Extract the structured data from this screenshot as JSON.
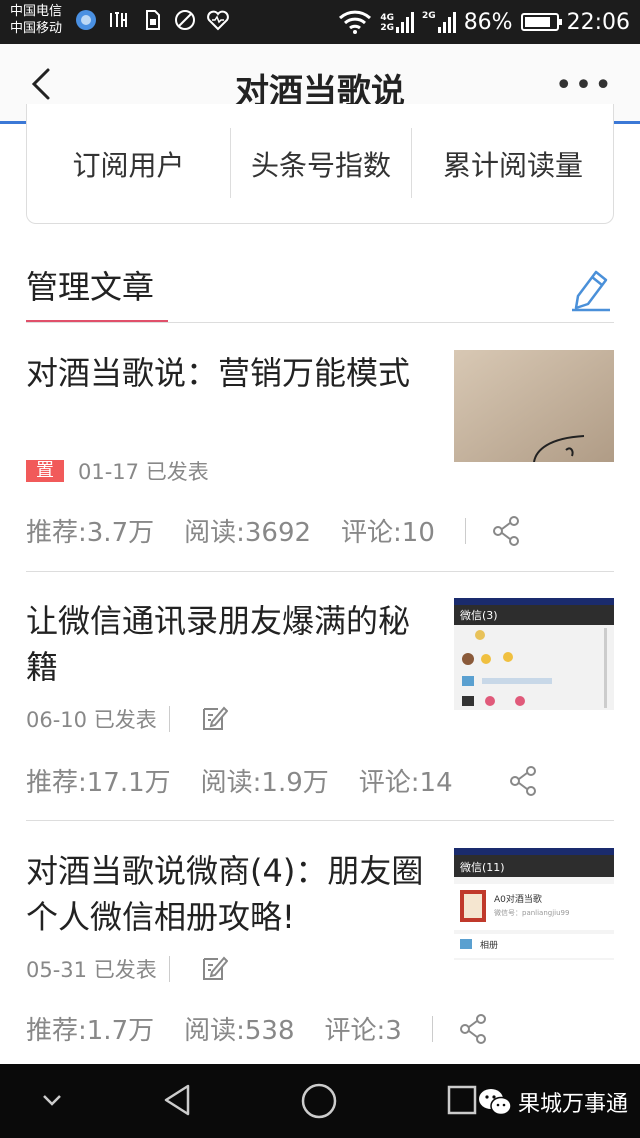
{
  "status_bar": {
    "carrier1": "中国电信",
    "carrier2": "中国移动",
    "net_tag1": "4G",
    "net_tag2": "2G",
    "net_tag3": "2G",
    "battery_percent": "86%",
    "battery_level": 0.86,
    "time": "22:06"
  },
  "header": {
    "title": "对酒当歌说"
  },
  "stats": {
    "subscribers_label": "订阅用户",
    "index_label": "头条号指数",
    "reads_label": "累计阅读量"
  },
  "manage": {
    "title": "管理文章"
  },
  "articles": [
    {
      "title": "对酒当歌说：营销万能模式",
      "pin": "置",
      "date": "01-17 已发表",
      "recommend": "推荐:3.7万",
      "reads": "阅读:3692",
      "comments": "评论:10"
    },
    {
      "title": "让微信通讯录朋友爆满的秘籍",
      "date": "06-10 已发表",
      "recommend": "推荐:17.1万",
      "reads": "阅读:1.9万",
      "comments": "评论:14",
      "thumb_header": "微信(3)"
    },
    {
      "title": "对酒当歌说微商(4)：朋友圈个人微信相册攻略!",
      "date": "05-31 已发表",
      "recommend": "推荐:1.7万",
      "reads": "阅读:538",
      "comments": "评论:3",
      "thumb_header": "微信(11)",
      "thumb_contact_name": "A0对酒当歌",
      "thumb_contact_id": "微信号：panliangjiu99",
      "thumb_album": "相册"
    }
  ],
  "watermark": "果城万事通",
  "colors": {
    "accent_blue": "#3b78d6",
    "accent_red": "#e0506a",
    "pin_red": "#f15a5a"
  }
}
